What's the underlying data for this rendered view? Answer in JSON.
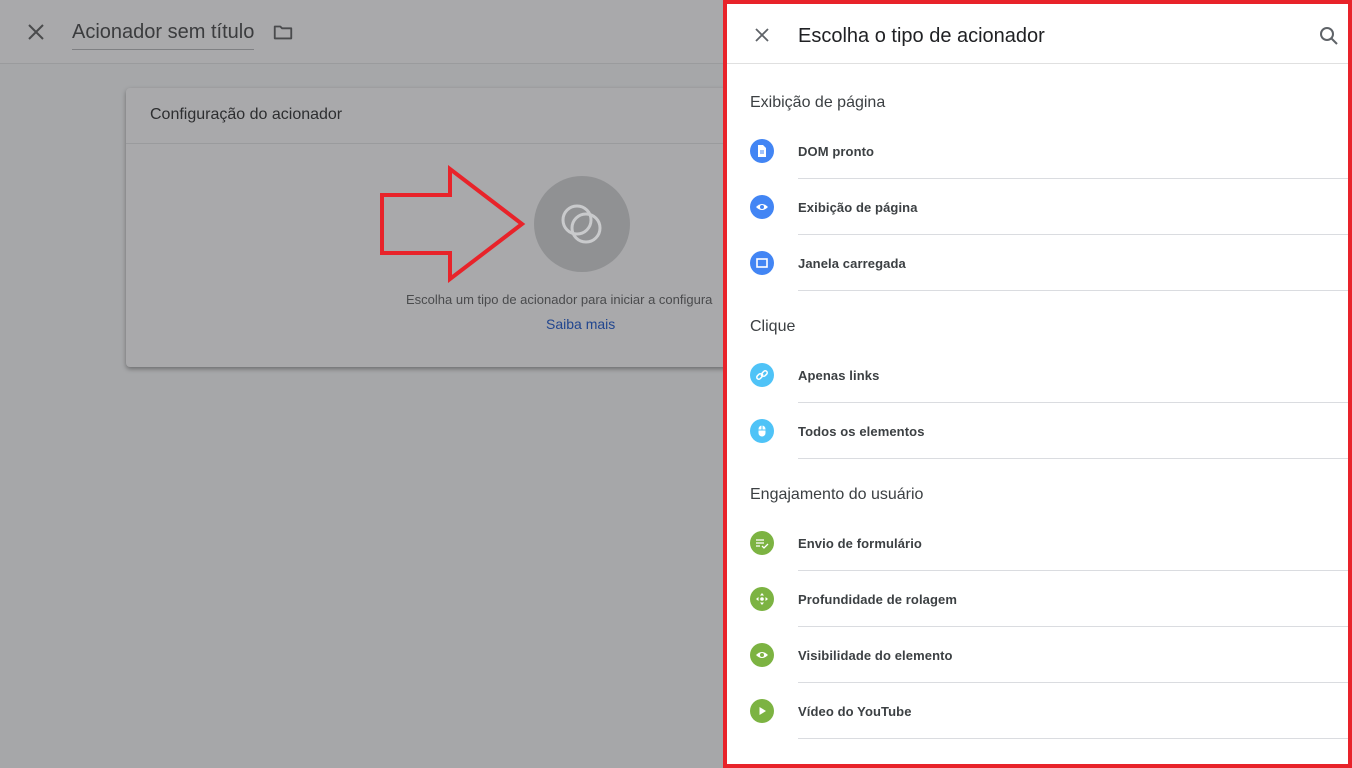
{
  "background": {
    "title": "Acionador sem título",
    "card_title": "Configuração do acionador",
    "card_text": "Escolha um tipo de acionador para iniciar a configura",
    "card_link": "Saiba mais"
  },
  "panel": {
    "title": "Escolha o tipo de acionador",
    "sections": [
      {
        "title": "Exibição de página",
        "items": [
          {
            "label": "DOM pronto",
            "icon": "document-icon",
            "color": "#4285f4"
          },
          {
            "label": "Exibição de página",
            "icon": "eye-icon",
            "color": "#4285f4"
          },
          {
            "label": "Janela carregada",
            "icon": "window-icon",
            "color": "#4285f4"
          }
        ]
      },
      {
        "title": "Clique",
        "items": [
          {
            "label": "Apenas links",
            "icon": "link-icon",
            "color": "#4fc3f7"
          },
          {
            "label": "Todos os elementos",
            "icon": "mouse-icon",
            "color": "#4fc3f7"
          }
        ]
      },
      {
        "title": "Engajamento do usuário",
        "items": [
          {
            "label": "Envio de formulário",
            "icon": "form-icon",
            "color": "#7cb342"
          },
          {
            "label": "Profundidade de rolagem",
            "icon": "scroll-icon",
            "color": "#7cb342"
          },
          {
            "label": "Visibilidade do elemento",
            "icon": "eye-icon",
            "color": "#7cb342"
          },
          {
            "label": "Vídeo do YouTube",
            "icon": "play-icon",
            "color": "#7cb342"
          }
        ]
      }
    ]
  },
  "colors": {
    "highlight_border": "#e8232a",
    "page_view": "#4285f4",
    "click": "#4fc3f7",
    "engagement": "#7cb342"
  }
}
